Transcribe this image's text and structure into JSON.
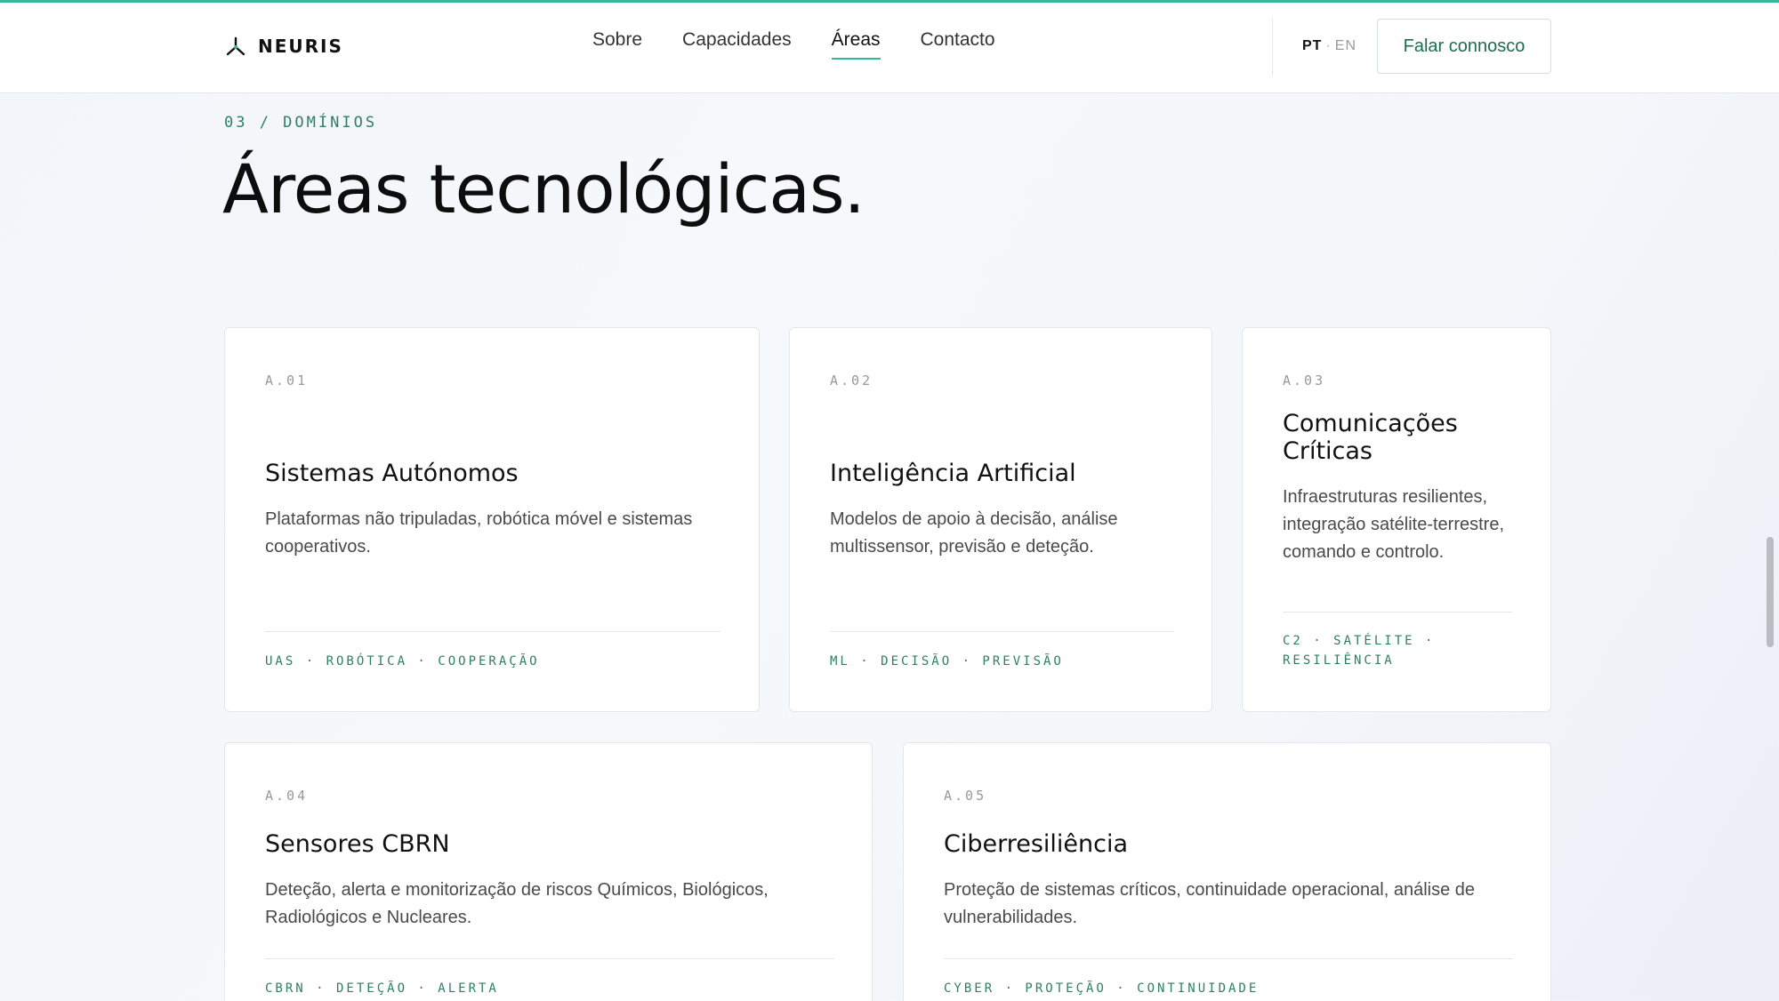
{
  "header": {
    "brand": "NEURIS",
    "nav": [
      "Sobre",
      "Capacidades",
      "Áreas",
      "Contacto"
    ],
    "active_nav": "Áreas",
    "lang_pt": "PT",
    "lang_sep": "·",
    "lang_en": "EN",
    "cta": "Falar connosco"
  },
  "section": {
    "eyebrow": "03 / DOMÍNIOS",
    "title": "Áreas tecnológicas."
  },
  "cards": [
    {
      "code": "A.01",
      "title": "Sistemas Autónomos",
      "desc": "Plataformas não tripuladas, robótica móvel e sistemas cooperativos.",
      "tags": "UAS · ROBÓTICA · COOPERAÇÃO"
    },
    {
      "code": "A.02",
      "title": "Inteligência Artificial",
      "desc": "Modelos de apoio à decisão, análise multissensor, previsão e deteção.",
      "tags": "ML · DECISÃO · PREVISÃO"
    },
    {
      "code": "A.03",
      "title": "Comunicações Críticas",
      "desc": "Infraestruturas resilientes, integração satélite-terrestre, comando e controlo.",
      "tags": "C2 · SATÉLITE · RESILIÊNCIA"
    },
    {
      "code": "A.04",
      "title": "Sensores CBRN",
      "desc": "Deteção, alerta e monitorização de riscos Químicos, Biológicos, Radiológicos e Nucleares.",
      "tags": "CBRN · DETEÇÃO · ALERTA"
    },
    {
      "code": "A.05",
      "title": "Ciberresiliência",
      "desc": "Proteção de sistemas críticos, continuidade operacional, análise de vulnerabilidades.",
      "tags": "CYBER · PROTEÇÃO · CONTINUIDADE"
    }
  ],
  "colors": {
    "accent": "#35b89a",
    "accent_text": "#2f7f63"
  },
  "icons": [
    "neuris-logo-icon"
  ]
}
